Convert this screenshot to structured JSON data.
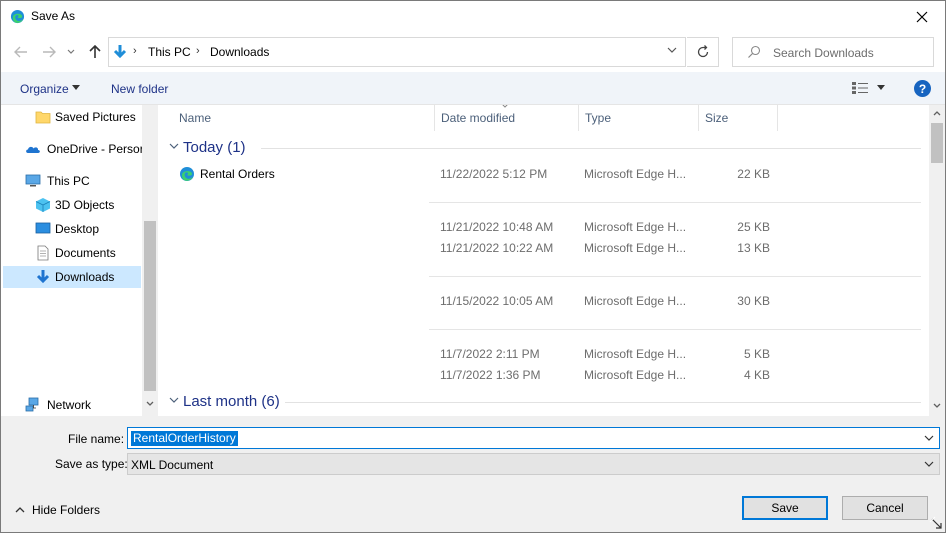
{
  "window": {
    "title": "Save As",
    "close_icon": "close-icon"
  },
  "nav": {
    "breadcrumbs": [
      "This PC",
      "Downloads"
    ],
    "search_placeholder": "Search Downloads"
  },
  "toolbar": {
    "organize": "Organize",
    "new_folder": "New folder",
    "help": "?"
  },
  "sidebar": {
    "items": [
      {
        "label": "Saved Pictures",
        "icon": "folder-icon"
      },
      {
        "label": "OneDrive - Persor",
        "icon": "onedrive-icon"
      },
      {
        "label": "This PC",
        "icon": "computer-icon"
      },
      {
        "label": "3D Objects",
        "icon": "3d-objects-icon"
      },
      {
        "label": "Desktop",
        "icon": "desktop-icon"
      },
      {
        "label": "Documents",
        "icon": "documents-icon"
      },
      {
        "label": "Downloads",
        "icon": "downloads-icon",
        "selected": true
      },
      {
        "label": "Network",
        "icon": "network-icon"
      }
    ]
  },
  "columns": {
    "name": "Name",
    "date": "Date modified",
    "type": "Type",
    "size": "Size"
  },
  "groups": {
    "today": "Today (1)",
    "last_month": "Last month (6)"
  },
  "files": [
    {
      "name": "Rental Orders",
      "date": "11/22/2022 5:12 PM",
      "type": "Microsoft Edge H...",
      "size": "22 KB"
    },
    {
      "name": "",
      "date": "11/21/2022 10:48 AM",
      "type": "Microsoft Edge H...",
      "size": "25 KB"
    },
    {
      "name": "",
      "date": "11/21/2022 10:22 AM",
      "type": "Microsoft Edge H...",
      "size": "13 KB"
    },
    {
      "name": "",
      "date": "11/15/2022 10:05 AM",
      "type": "Microsoft Edge H...",
      "size": "30 KB"
    },
    {
      "name": "",
      "date": "11/7/2022 2:11 PM",
      "type": "Microsoft Edge H...",
      "size": "5 KB"
    },
    {
      "name": "",
      "date": "11/7/2022 1:36 PM",
      "type": "Microsoft Edge H...",
      "size": "4 KB"
    }
  ],
  "form": {
    "file_name_label": "File name:",
    "file_name_value": "RentalOrderHistory",
    "save_type_label": "Save as type:",
    "save_type_value": "XML Document",
    "hide_folders": "Hide Folders",
    "save": "Save",
    "cancel": "Cancel"
  },
  "colors": {
    "accent": "#0078d7",
    "link": "#1e3287",
    "selection": "#cce8ff"
  }
}
